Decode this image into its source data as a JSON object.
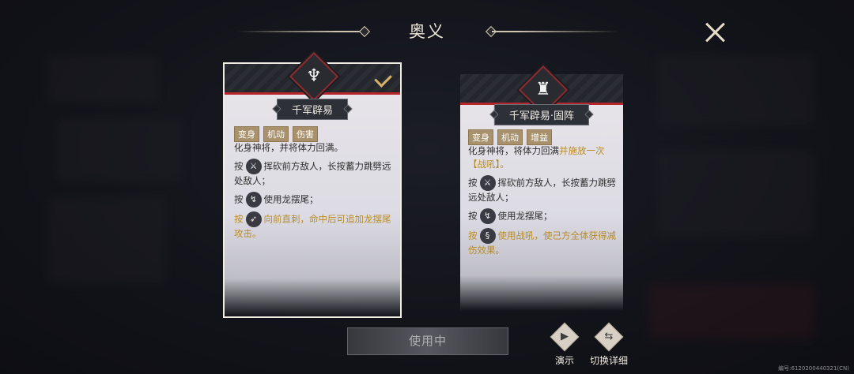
{
  "header": {
    "title": "奥义"
  },
  "cards": [
    {
      "name": "千军辟易",
      "tags": [
        "变身",
        "机动",
        "伤害"
      ],
      "lines": [
        {
          "prefix": "",
          "text": "化身神将，并将体力回满。",
          "icon": ""
        },
        {
          "prefix": "按",
          "text": "挥砍前方敌人，长按蓄力跳劈远处敌人；",
          "icon": "slash-skill-icon"
        },
        {
          "prefix": "按",
          "text": "使用龙摆尾；",
          "icon": "tail-skill-icon"
        },
        {
          "prefix": "按",
          "text": "向前直刺，命中后可追加龙摆尾攻击。",
          "icon": "thrust-skill-icon",
          "highlight": true
        }
      ]
    },
    {
      "name": "千军辟易·固阵",
      "tags": [
        "变身",
        "机动",
        "增益"
      ],
      "lines": [
        {
          "prefix": "",
          "text": "化身神将，将体力回满",
          "extra": "并施放一次【战吼】。",
          "icon": ""
        },
        {
          "prefix": "按",
          "text": "挥砍前方敌人，长按蓄力跳劈远处敌人；",
          "icon": "slash-skill-icon"
        },
        {
          "prefix": "按",
          "text": "使用龙摆尾；",
          "icon": "tail-skill-icon"
        },
        {
          "prefix": "按",
          "text": "使用战吼，使己方全体获得减伤效果。",
          "icon": "roar-skill-icon",
          "highlight": true
        }
      ]
    }
  ],
  "bottom": {
    "use_button": "使用中",
    "demo_label": "演示",
    "switch_label": "切换详细"
  },
  "footer": {
    "id_text": "编号:6120200440321(CN)"
  },
  "colors": {
    "accent_red": "#b8262c",
    "gold": "#b78b2a",
    "tag_bg": "#a8916b"
  }
}
